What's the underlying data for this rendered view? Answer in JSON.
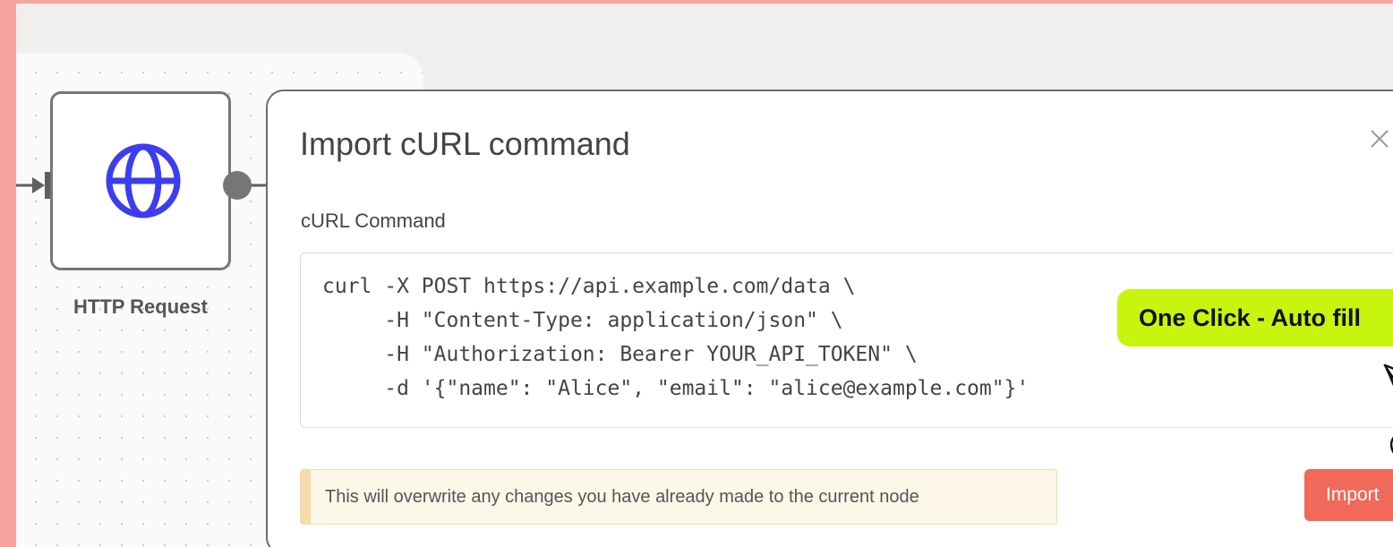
{
  "node": {
    "label": "HTTP Request",
    "icon": "globe-icon"
  },
  "modal": {
    "title": "Import cURL command",
    "field_label": "cURL Command",
    "command": "curl -X POST https://api.example.com/data \\\n     -H \"Content-Type: application/json\" \\\n     -H \"Authorization: Bearer YOUR_API_TOKEN\" \\\n     -d '{\"name\": \"Alice\", \"email\": \"alice@example.com\"}'",
    "warning": "This will overwrite any changes you have already made to the current node",
    "import_label": "Import"
  },
  "annotation": {
    "label": "One Click - Auto fill"
  },
  "colors": {
    "frame": "#f7a4a1",
    "accent": "#f0695a",
    "badge": "#c8f50e",
    "icon": "#3d3df0"
  }
}
